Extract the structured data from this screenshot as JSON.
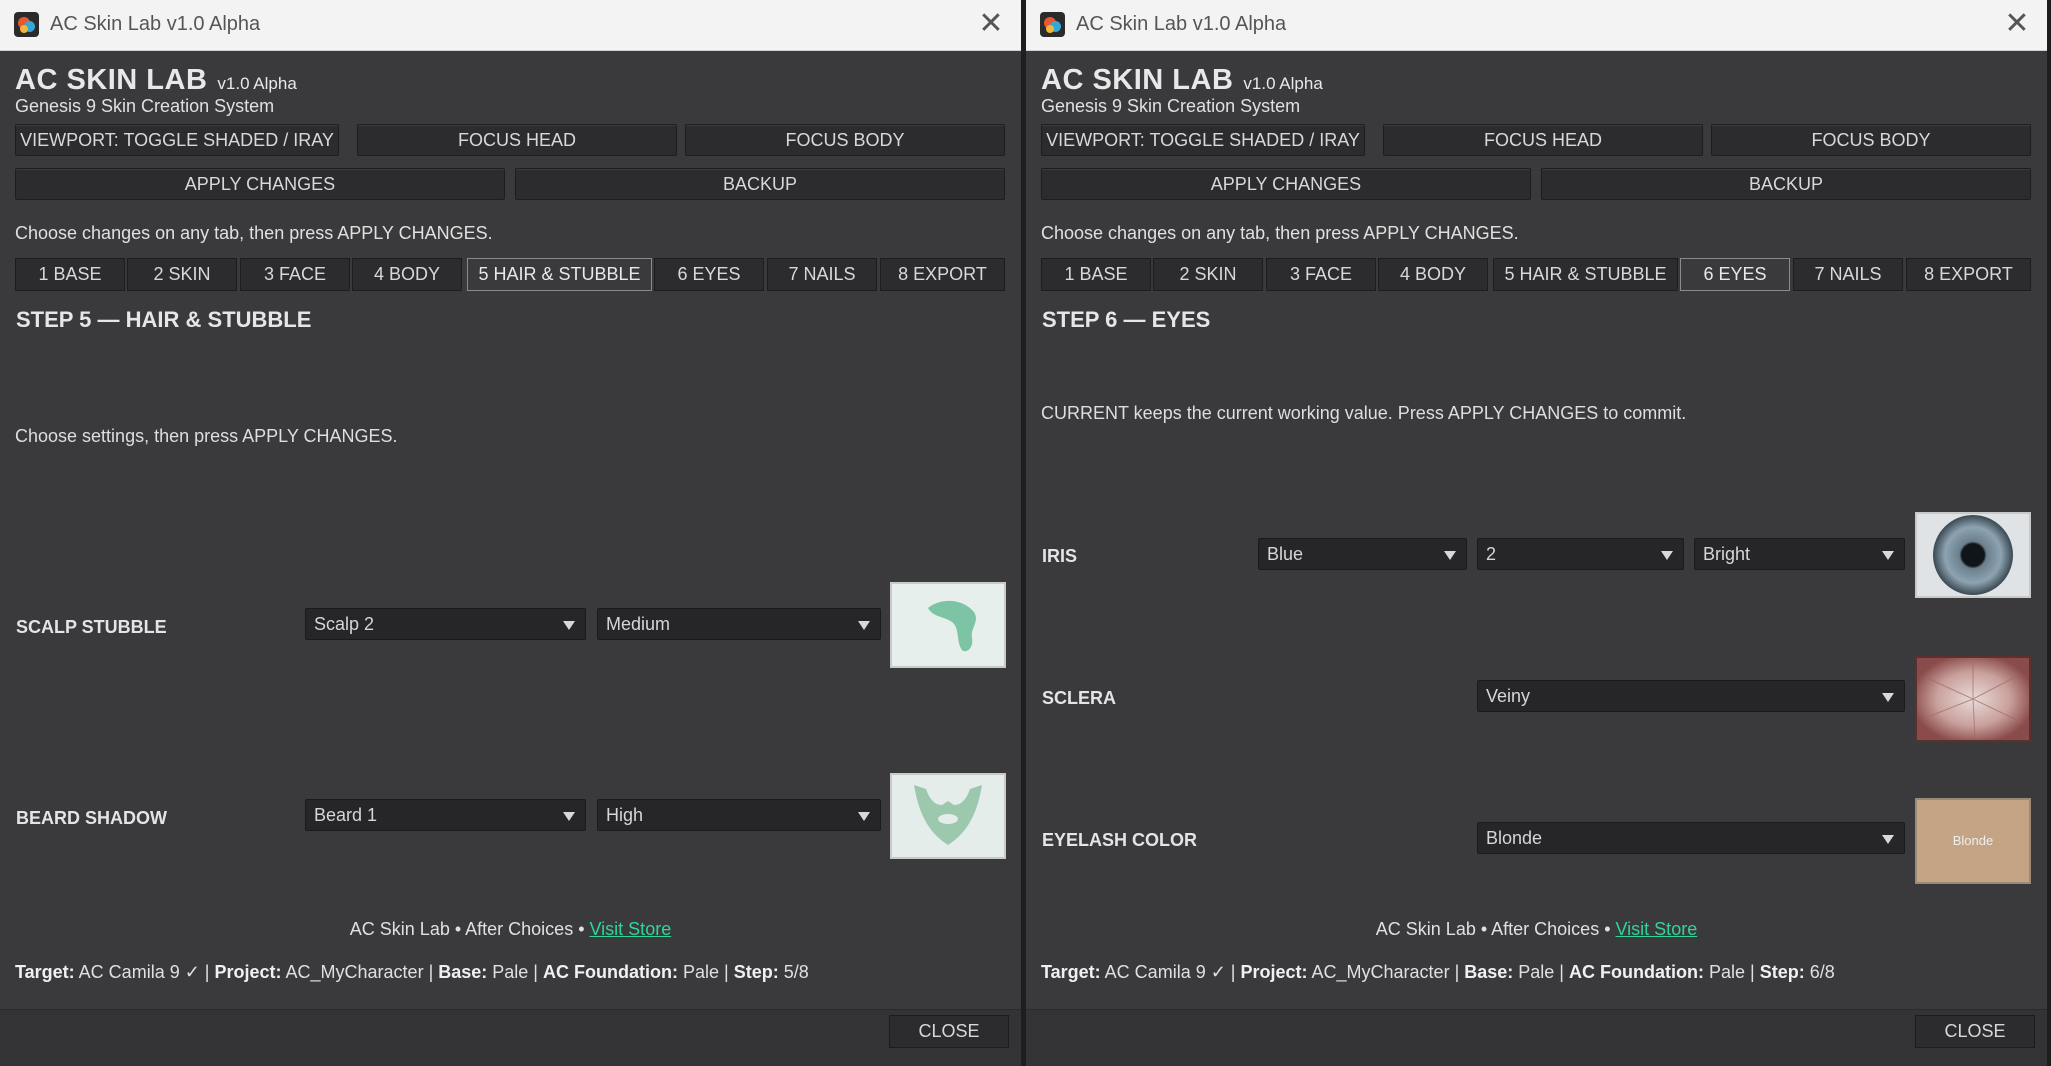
{
  "left": {
    "window_title": "AC Skin Lab v1.0 Alpha",
    "app_title": "AC SKIN LAB",
    "version": "v1.0 Alpha",
    "subtitle": "Genesis 9 Skin Creation System",
    "toolbar": {
      "viewport": "VIEWPORT: TOGGLE SHADED / IRAY",
      "focus_head": "FOCUS HEAD",
      "focus_body": "FOCUS BODY",
      "apply": "APPLY CHANGES",
      "backup": "BACKUP"
    },
    "hint": "Choose changes on any tab, then press APPLY CHANGES.",
    "tabs": [
      "1 BASE",
      "2 SKIN",
      "3 FACE",
      "4 BODY",
      "5 HAIR & STUBBLE",
      "6 EYES",
      "7 NAILS",
      "8 EXPORT"
    ],
    "active_tab": "5 HAIR & STUBBLE",
    "step_title": "STEP 5 — HAIR & STUBBLE",
    "note": "Choose settings, then press APPLY CHANGES.",
    "rows": [
      {
        "label": "SCALP STUBBLE",
        "choice1": "Scalp 2",
        "choice2": "Medium",
        "thumb": "scalp-stubble-preview"
      },
      {
        "label": "BEARD SHADOW",
        "choice1": "Beard 1",
        "choice2": "High",
        "thumb": "beard-shadow-preview"
      }
    ],
    "footer": {
      "text": "AC Skin Lab • After Choices • ",
      "link": "Visit Store"
    },
    "status": {
      "target_label": "Target:",
      "target": " AC Camila 9 ✓ | ",
      "project_label": "Project:",
      "project": " AC_MyCharacter | ",
      "base_label": "Base:",
      "base": " Pale | ",
      "foundation_label": "AC Foundation:",
      "foundation": " Pale | ",
      "step_label": "Step:",
      "step": " 5/8"
    },
    "close": "CLOSE"
  },
  "right": {
    "window_title": "AC Skin Lab v1.0 Alpha",
    "app_title": "AC SKIN LAB",
    "version": "v1.0 Alpha",
    "subtitle": "Genesis 9 Skin Creation System",
    "toolbar": {
      "viewport": "VIEWPORT: TOGGLE SHADED / IRAY",
      "focus_head": "FOCUS HEAD",
      "focus_body": "FOCUS BODY",
      "apply": "APPLY CHANGES",
      "backup": "BACKUP"
    },
    "hint": "Choose changes on any tab, then press APPLY CHANGES.",
    "tabs": [
      "1 BASE",
      "2 SKIN",
      "3 FACE",
      "4 BODY",
      "5 HAIR & STUBBLE",
      "6 EYES",
      "7 NAILS",
      "8 EXPORT"
    ],
    "active_tab": "6 EYES",
    "step_title": "STEP 6 — EYES",
    "note": "CURRENT keeps the current working value. Press APPLY CHANGES to commit.",
    "iris": {
      "label": "IRIS",
      "color": "Blue",
      "variant": "2",
      "brightness": "Bright"
    },
    "sclera": {
      "label": "SCLERA",
      "choice": "Veiny"
    },
    "eyelash": {
      "label": "EYELASH COLOR",
      "choice": "Blonde",
      "swatch_text": "Blonde",
      "swatch_color": "#c4a484"
    },
    "footer": {
      "text": "AC Skin Lab • After Choices • ",
      "link": "Visit Store"
    },
    "status": {
      "target_label": "Target:",
      "target": " AC Camila 9 ✓ | ",
      "project_label": "Project:",
      "project": " AC_MyCharacter | ",
      "base_label": "Base:",
      "base": " Pale | ",
      "foundation_label": "AC Foundation:",
      "foundation": " Pale | ",
      "step_label": "Step:",
      "step": " 6/8"
    },
    "close": "CLOSE"
  }
}
